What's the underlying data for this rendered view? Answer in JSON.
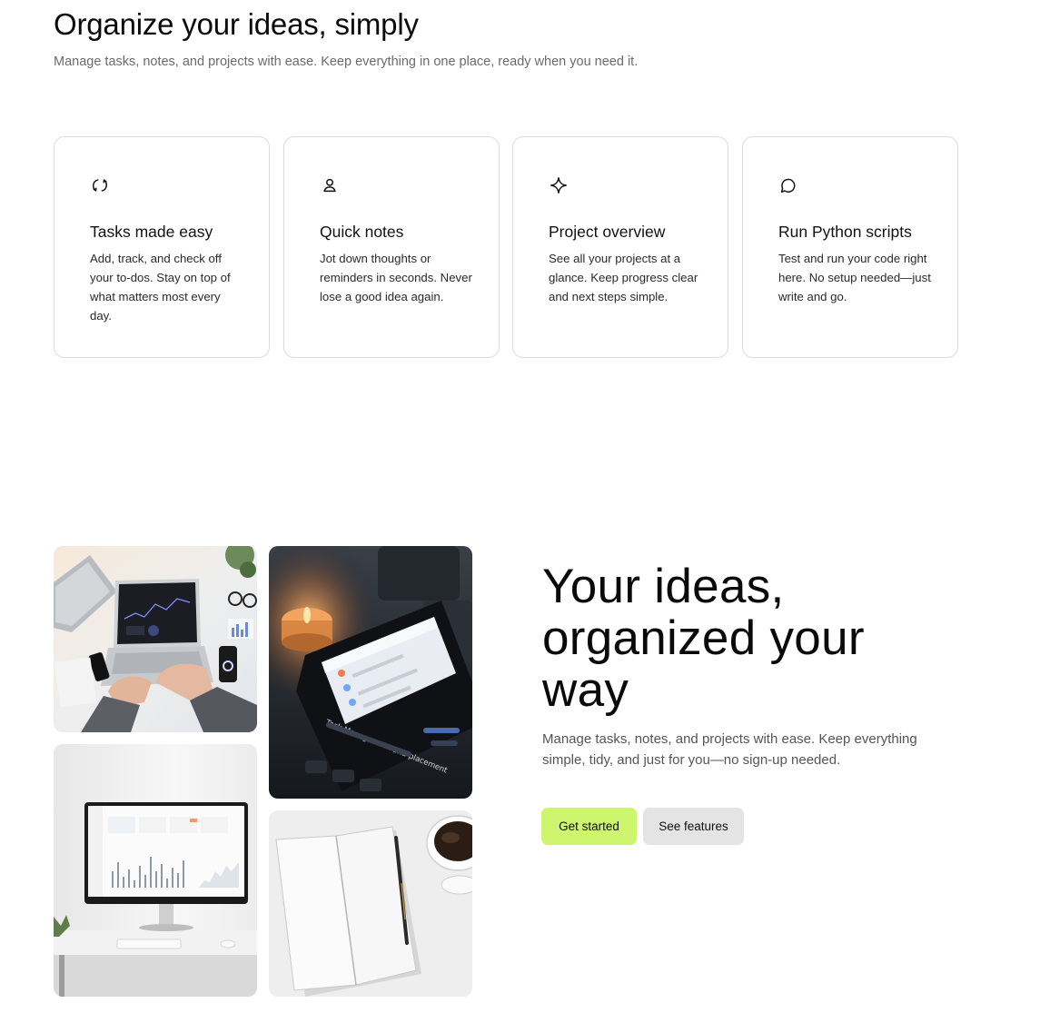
{
  "intro": {
    "title": "Organize your ideas, simply",
    "subtitle": "Manage tasks, notes, and projects with ease. Keep everything in one place, ready when you need it."
  },
  "features": [
    {
      "icon": "refresh-icon",
      "title": "Tasks made easy",
      "description": "Add, track, and check off your to-dos. Stay on top of what matters most every day."
    },
    {
      "icon": "user-icon",
      "title": "Quick notes",
      "description": "Jot down thoughts or reminders in seconds. Never lose a good idea again."
    },
    {
      "icon": "sparkle-icon",
      "title": "Project overview",
      "description": "See all your projects at a glance. Keep progress clear and next steps simple."
    },
    {
      "icon": "chat-bubble-icon",
      "title": "Run Python scripts",
      "description": "Test and run your code right here. No setup needed—just write and go."
    }
  ],
  "hero": {
    "title": "Your ideas, organized your way",
    "subtitle": "Manage tasks, notes, and projects with ease. Keep everything simple, tidy, and just for you—no sign-up needed.",
    "primary_button": "Get started",
    "secondary_button": "See features",
    "accent_color": "#cdf56e",
    "secondary_color": "#e4e4e4"
  },
  "gallery": {
    "image_1_text": "Task Management and placement"
  }
}
